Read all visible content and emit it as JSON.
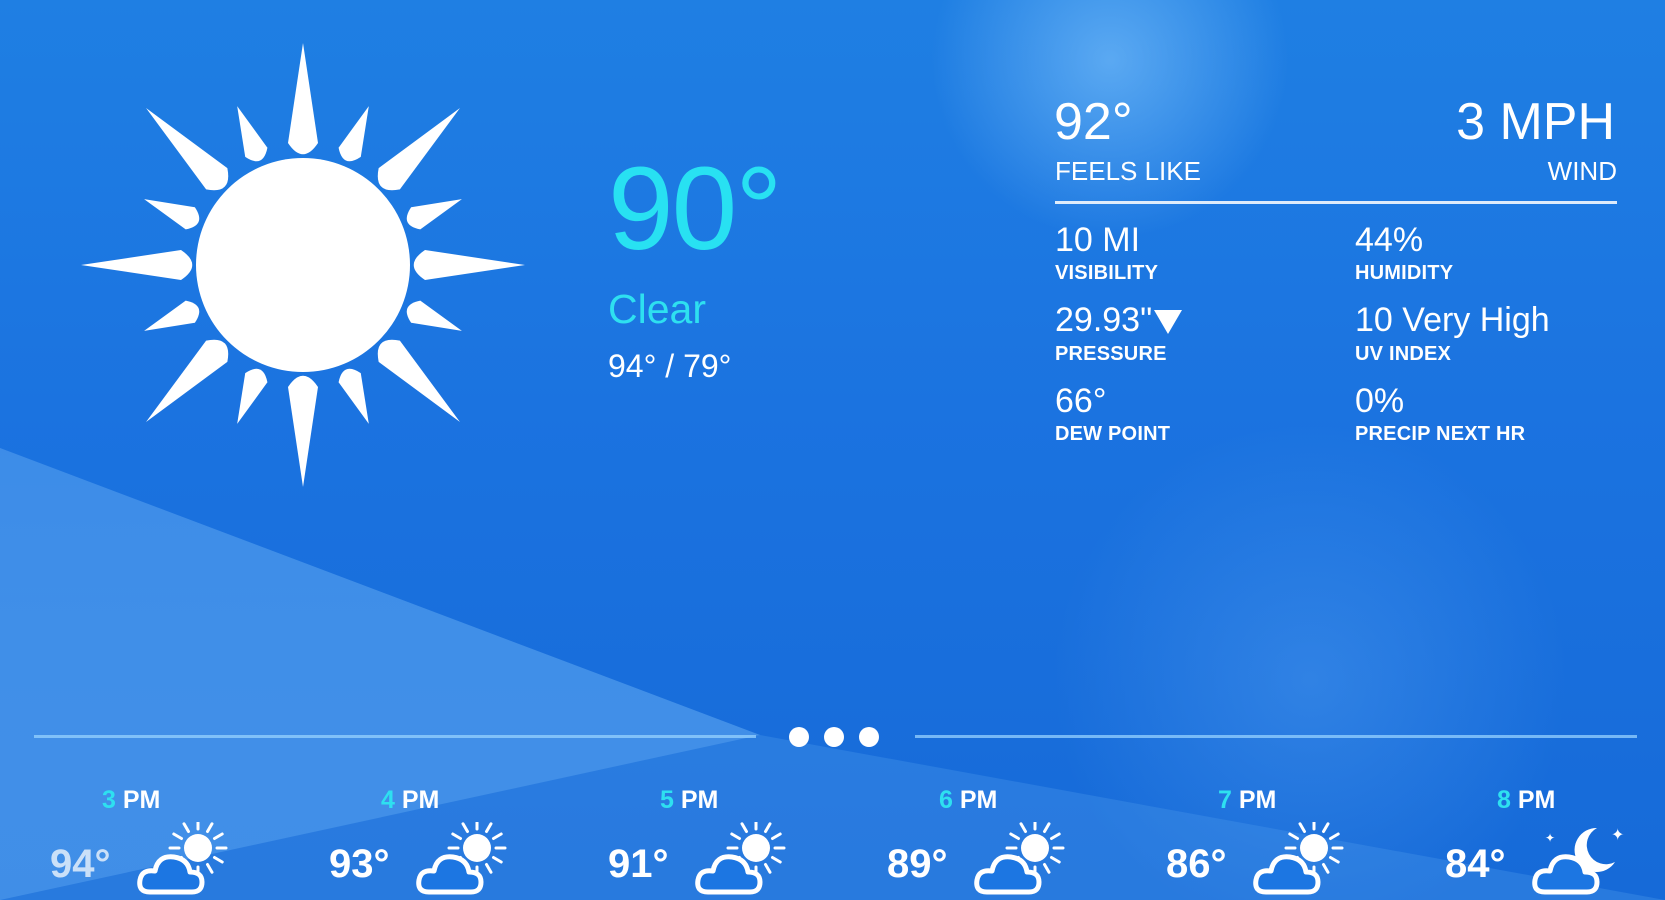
{
  "current": {
    "temperature": "90°",
    "condition": "Clear",
    "high_low": "94° / 79°",
    "icon": "sun-icon"
  },
  "details": {
    "feels_like": {
      "value": "92°",
      "label": "FEELS LIKE"
    },
    "wind": {
      "value": "3 MPH",
      "label": "WIND"
    },
    "stats": [
      {
        "value": "10 MI",
        "label": "VISIBILITY"
      },
      {
        "value": "44%",
        "label": "HUMIDITY"
      },
      {
        "value": "29.93\"",
        "label": "PRESSURE",
        "trend_icon": "down-arrow-icon"
      },
      {
        "value": "10 Very High",
        "label": "UV INDEX"
      },
      {
        "value": "66°",
        "label": "DEW POINT"
      },
      {
        "value": "0%",
        "label": "PRECIP NEXT HR"
      }
    ]
  },
  "pager": {
    "pages": 3,
    "active_index": 0
  },
  "hourly": [
    {
      "hour": "3",
      "period": "PM",
      "temp": "94°",
      "icon": "partly-sunny-icon"
    },
    {
      "hour": "4",
      "period": "PM",
      "temp": "93°",
      "icon": "partly-sunny-icon"
    },
    {
      "hour": "5",
      "period": "PM",
      "temp": "91°",
      "icon": "partly-sunny-icon"
    },
    {
      "hour": "6",
      "period": "PM",
      "temp": "89°",
      "icon": "partly-sunny-icon"
    },
    {
      "hour": "7",
      "period": "PM",
      "temp": "86°",
      "icon": "partly-sunny-icon"
    },
    {
      "hour": "8",
      "period": "PM",
      "temp": "84°",
      "icon": "partly-cloudy-night-icon"
    }
  ],
  "colors": {
    "accent": "#28e1f2",
    "background": "#1b73e0"
  }
}
